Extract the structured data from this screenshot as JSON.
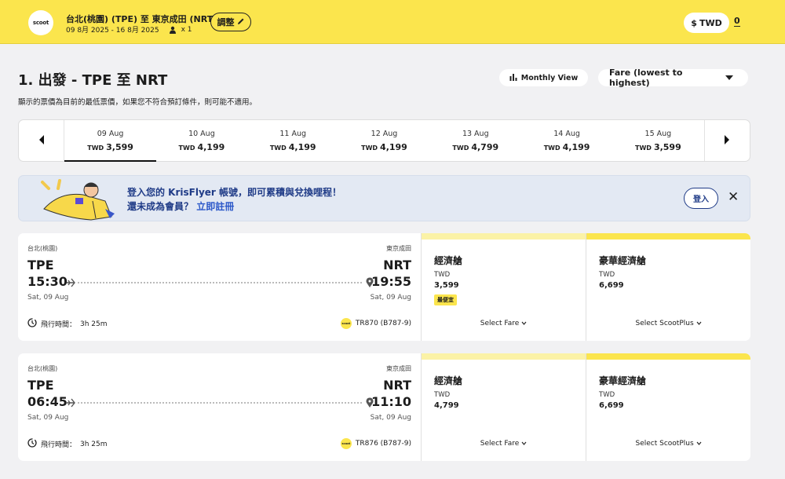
{
  "header": {
    "logo_text": "scoot",
    "route": "台北(桃園) (TPE) 至 東京成田 (NRT)",
    "dates": "09 8月 2025 - 16 8月 2025",
    "passengers": "x 1",
    "adjust_label": "調整",
    "currency_label": "TWD",
    "currency_symbol": "$",
    "cart_count": "0"
  },
  "page": {
    "title": "1. 出發 - TPE 至 NRT",
    "subtitle": "顯示的票價為目前的最低票價，如果您不符合預訂條件，則可能不適用。",
    "monthly_view_label": "Monthly View",
    "sort_label": "Fare (lowest to highest)"
  },
  "date_strip": {
    "currency": "TWD",
    "days": [
      {
        "date": "09 Aug",
        "price": "3,599",
        "selected": true
      },
      {
        "date": "10 Aug",
        "price": "4,199"
      },
      {
        "date": "11 Aug",
        "price": "4,199"
      },
      {
        "date": "12 Aug",
        "price": "4,199"
      },
      {
        "date": "13 Aug",
        "price": "4,799"
      },
      {
        "date": "14 Aug",
        "price": "4,199"
      },
      {
        "date": "15 Aug",
        "price": "3,599"
      }
    ]
  },
  "krisflyer": {
    "line1": "登入您的 KrisFlyer 帳號，即可累積與兌換哩程！",
    "line2_prefix": "還未成為會員？",
    "line2_link": "立即註冊",
    "login_label": "登入",
    "close_label": "✕"
  },
  "flights": [
    {
      "origin_city": "台北(桃園)",
      "dest_city": "東京成田",
      "origin_code": "TPE",
      "dest_code": "NRT",
      "depart_time": "15:30",
      "arrive_time": "19:55",
      "depart_date": "Sat, 09 Aug",
      "arrive_date": "Sat, 09 Aug",
      "duration_label": "飛行時間：",
      "duration": "3h 25m",
      "flight_no": "TR870 (B787-9)",
      "economy": {
        "name": "經濟艙",
        "currency": "TWD",
        "price": "3,599",
        "badge": "最便宜",
        "select_label": "Select Fare"
      },
      "plus": {
        "name": "豪華經濟艙",
        "currency": "TWD",
        "price": "6,699",
        "select_label": "Select ScootPlus"
      }
    },
    {
      "origin_city": "台北(桃園)",
      "dest_city": "東京成田",
      "origin_code": "TPE",
      "dest_code": "NRT",
      "depart_time": "06:45",
      "arrive_time": "11:10",
      "depart_date": "Sat, 09 Aug",
      "arrive_date": "Sat, 09 Aug",
      "duration_label": "飛行時間：",
      "duration": "3h 25m",
      "flight_no": "TR876 (B787-9)",
      "economy": {
        "name": "經濟艙",
        "currency": "TWD",
        "price": "4,799",
        "select_label": "Select Fare"
      },
      "plus": {
        "name": "豪華經濟艙",
        "currency": "TWD",
        "price": "6,699",
        "select_label": "Select ScootPlus"
      }
    }
  ],
  "colors": {
    "brand_yellow": "#fbe54d",
    "krisflyer_blue": "#1f3b87"
  }
}
